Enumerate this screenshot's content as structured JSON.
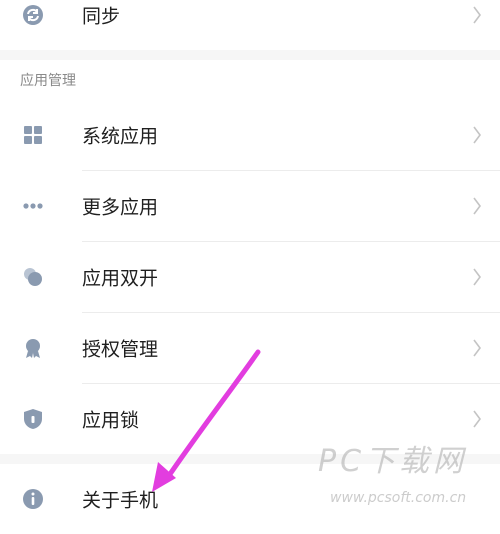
{
  "top_item": {
    "label": "同步",
    "icon": "sync-icon"
  },
  "section": {
    "title": "应用管理",
    "items": [
      {
        "label": "系统应用",
        "icon": "grid-icon"
      },
      {
        "label": "更多应用",
        "icon": "more-dots-icon"
      },
      {
        "label": "应用双开",
        "icon": "dual-app-icon"
      },
      {
        "label": "授权管理",
        "icon": "badge-icon"
      },
      {
        "label": "应用锁",
        "icon": "shield-lock-icon"
      }
    ]
  },
  "bottom_item": {
    "label": "关于手机",
    "icon": "info-icon"
  },
  "watermark": {
    "brand": "PC下载网",
    "url": "www.pcsoft.com.cn"
  },
  "colors": {
    "icon": "#8a9ab0",
    "chevron": "#c4c4c4",
    "annotation_arrow": "#e23ddf",
    "section_bg": "#f6f6f6"
  }
}
